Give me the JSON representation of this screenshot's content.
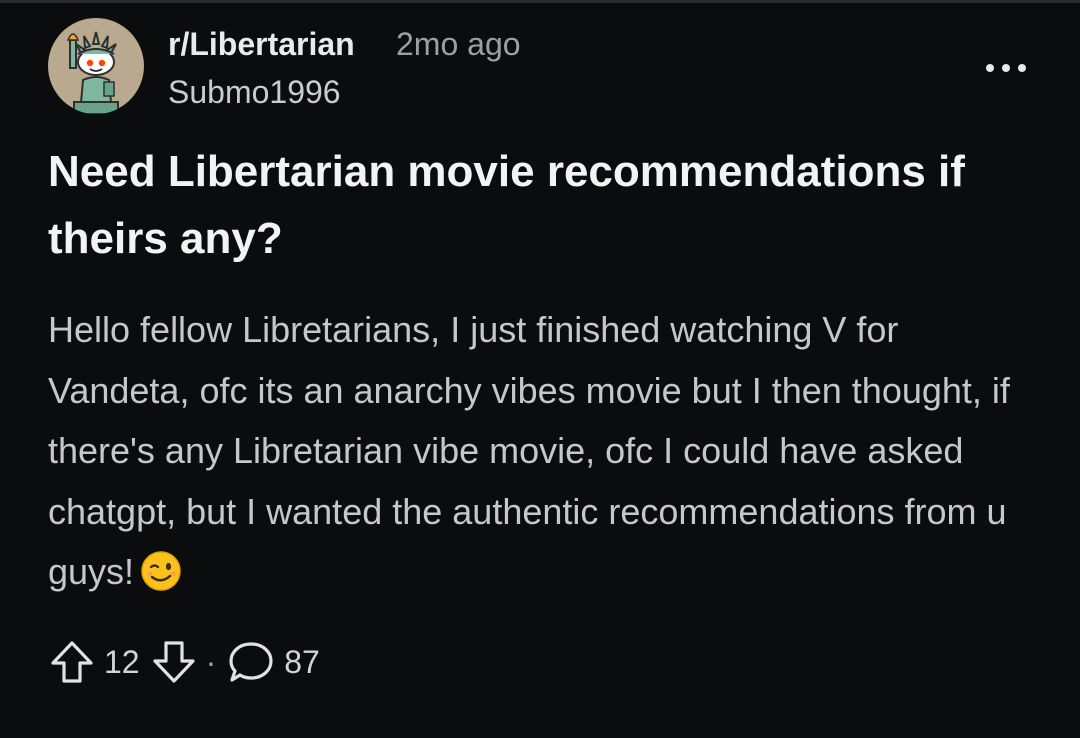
{
  "post": {
    "subreddit": "r/Libertarian",
    "age": "2mo ago",
    "author": "Submo1996",
    "title": "Need Libertarian movie recommendations if theirs any?",
    "body": "Hello fellow Libretarians, I just finished watching V for Vandeta, ofc its an anarchy vibes movie but I then thought, if there's any Libretarian vibe movie, ofc I could have asked chatgpt, but I wanted the authentic recommendations from u guys!",
    "body_emoji": "winking-face",
    "avatar_icon": "statue-of-liberty-snoo-icon"
  },
  "actions": {
    "upvote_icon": "upvote-arrow-icon",
    "score": "12",
    "downvote_icon": "downvote-arrow-icon",
    "separator": "·",
    "comment_icon": "comment-bubble-icon",
    "comments": "87",
    "more_icon": "more-options-icon"
  },
  "colors": {
    "background": "#0b0c0e",
    "text_primary": "#f1f3f4",
    "text_secondary": "#9aa0a6",
    "avatar_bg": "#b8a98f"
  }
}
